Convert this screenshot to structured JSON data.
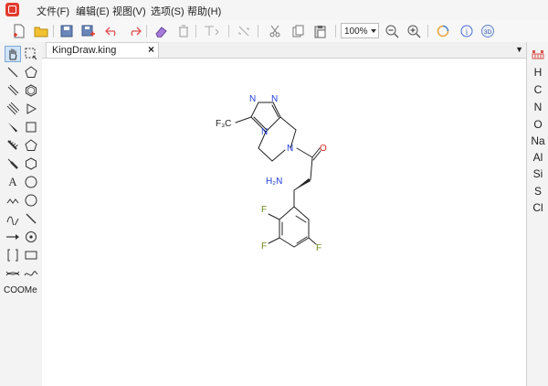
{
  "menu": [
    "文件(F)",
    "编辑(E)",
    "视图(V)",
    "选项(S)",
    "帮助(H)"
  ],
  "toolbar": {
    "zoom": "100%",
    "icons": [
      "new-icon",
      "open-icon",
      "save-icon",
      "save-as-icon",
      "undo-icon",
      "redo-icon",
      "eraser-icon",
      "delete-icon",
      "align-icon",
      "flip-icon",
      "cut-icon",
      "copy-icon",
      "paste-icon",
      "zoom-out-icon",
      "zoom-in-icon",
      "color-ring-icon",
      "info-icon",
      "3d-icon"
    ]
  },
  "document": {
    "tab_title": "KingDraw.king",
    "close": "×"
  },
  "palette": {
    "text_tool": "A",
    "coome_label": "COOMe"
  },
  "elements": [
    "H",
    "C",
    "N",
    "O",
    "Na",
    "Al",
    "Si",
    "S",
    "Cl"
  ],
  "molecule": {
    "atoms": {
      "n1": "N",
      "n2": "N",
      "n3": "N",
      "n4": "N",
      "cf3": "F₃C",
      "amine": "H₂N",
      "oxygen": "O",
      "f1": "F",
      "f2": "F",
      "f3": "F"
    }
  },
  "colors": {
    "accent": "#e23b2e",
    "oxygen": "#d12020",
    "nitrogen": "#1f3fd6",
    "fluorine": "#6b8a1b",
    "bond": "#222222"
  }
}
